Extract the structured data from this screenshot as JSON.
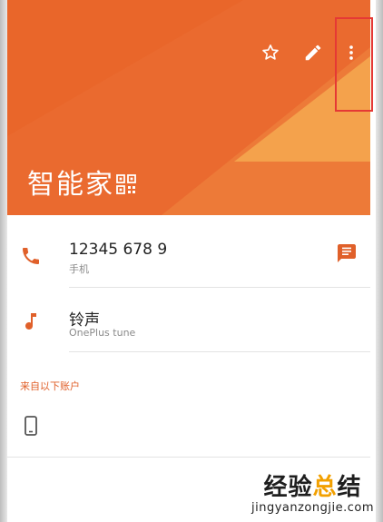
{
  "header": {
    "contact_name": "智能家",
    "colors": {
      "primary": "#ea6a2f",
      "accent_triangle": "#f4a24c",
      "highlight": "#e53935"
    },
    "actions": [
      {
        "name": "favorite",
        "icon": "star-outline-icon"
      },
      {
        "name": "edit",
        "icon": "pencil-icon"
      },
      {
        "name": "more",
        "icon": "overflow-menu-icon"
      }
    ]
  },
  "phone": {
    "number": "12345 678 9",
    "type": "手机",
    "icon": "phone-icon",
    "action_icon": "message-icon"
  },
  "ringtone": {
    "label": "铃声",
    "value": "OnePlus tune",
    "icon": "music-note-icon"
  },
  "accounts": {
    "header": "来自以下账户",
    "icon": "device-phone-icon"
  },
  "watermark": {
    "text_a": "经验",
    "text_b": "总",
    "text_c": "结",
    "url": "jingyanzongjie.com"
  }
}
